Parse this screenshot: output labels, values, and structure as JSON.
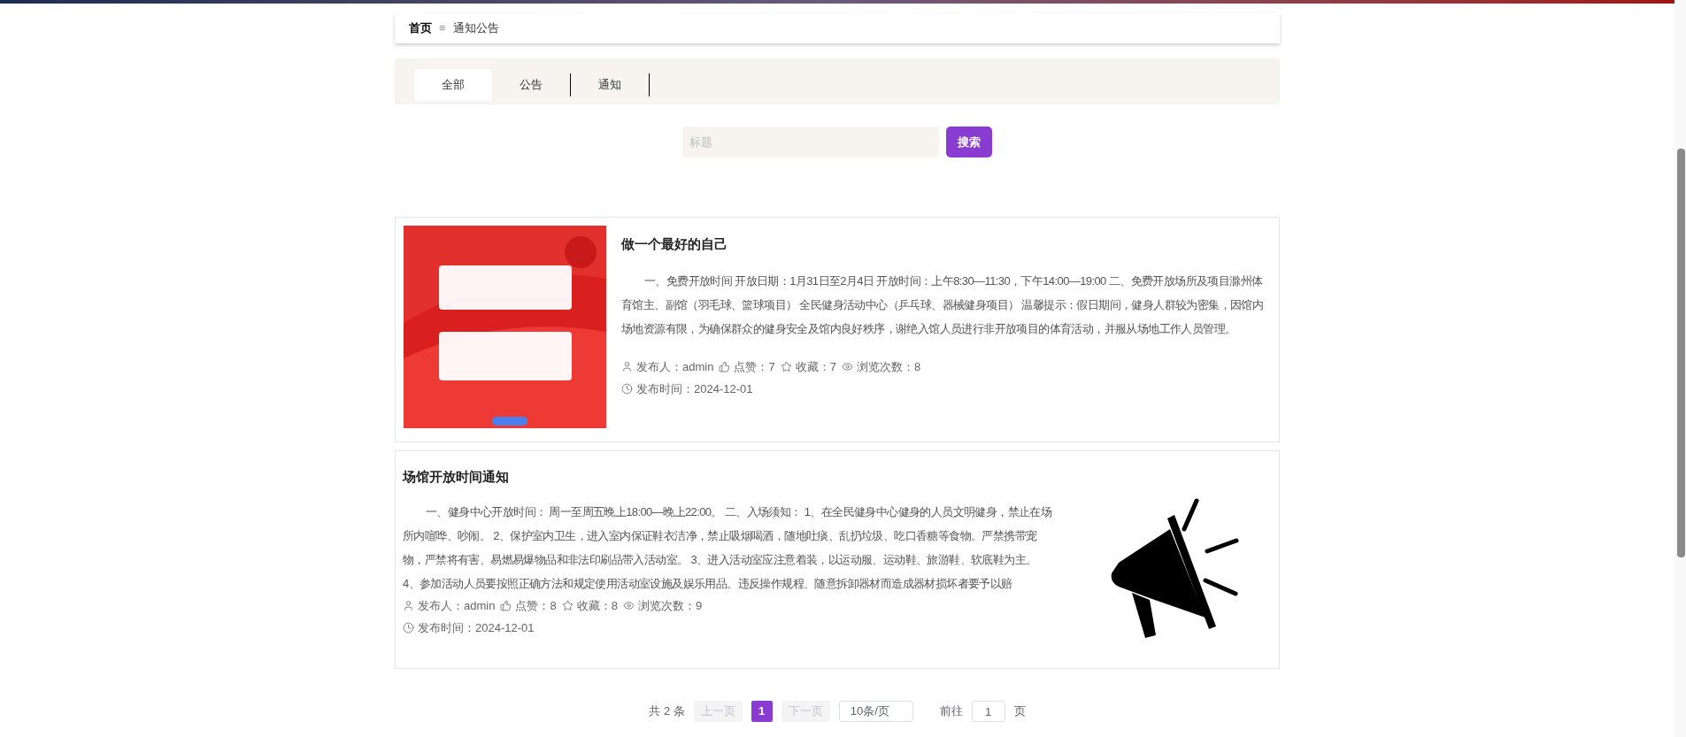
{
  "breadcrumb": {
    "home": "首页",
    "separator": "≡",
    "current": "通知公告"
  },
  "tabs": [
    {
      "label": "全部",
      "selected": true
    },
    {
      "label": "公告",
      "selected": false
    },
    {
      "label": "通知",
      "selected": false
    }
  ],
  "search": {
    "placeholder": "标题",
    "button": "搜索"
  },
  "posts": [
    {
      "kind": "image-left",
      "title": "做一个最好的自己",
      "body": "一、免费开放时间 开放日期：1月31日至2月4日 开放时间：上午8:30—11:30，下午14:00—19:00 二、免费开放场所及项目滁州体育馆主、副馆（羽毛球、篮球项目） 全民健身活动中心（乒乓球、器械健身项目） 温馨提示：假日期间，健身人群较为密集，因馆内场地资源有限，为确保群众的健身安全及馆内良好秩序，谢绝入馆人员进行非开放项目的体育活动，并服从场地工作人员管理。",
      "author": "发布人：admin",
      "likes": "点赞：7",
      "favorites": "收藏：7",
      "views": "浏览次数：8",
      "date": "发布时间：2024-12-01"
    },
    {
      "kind": "image-right",
      "title": "场馆开放时间通知",
      "body": "一、健身中心开放时间： 周一至周五晚上18:00—晚上22:00。 二、入场须知： 1、在全民健身中心健身的人员文明健身，禁止在场所内喧哗、吵闹。 2、保护室内卫生，进入室内保证鞋衣洁净，禁止吸烟喝酒，随地吐痰、乱扔垃圾、吃口香糖等食物。严禁携带宠物，严禁将有害、易燃易爆物品和非法印刷品带入活动室。 3、进入活动室应注意着装，以运动服、运动鞋、旅游鞋、软底鞋为主。 4、参加活动人员要按照正确方法和规定使用活动室设施及娱乐用品。违反操作规程、随意拆卸器材而造成器材损坏者要予以赔",
      "author": "发布人：admin",
      "likes": "点赞：8",
      "favorites": "收藏：8",
      "views": "浏览次数：9",
      "date": "发布时间：2024-12-01"
    }
  ],
  "pagination": {
    "total": "共 2 条",
    "prev": "上一页",
    "pages": [
      {
        "label": "1",
        "selected": true
      }
    ],
    "next": "下一页",
    "page_size": "10条/页",
    "goto": "前往",
    "goto_value": "1",
    "page_unit": "页"
  }
}
